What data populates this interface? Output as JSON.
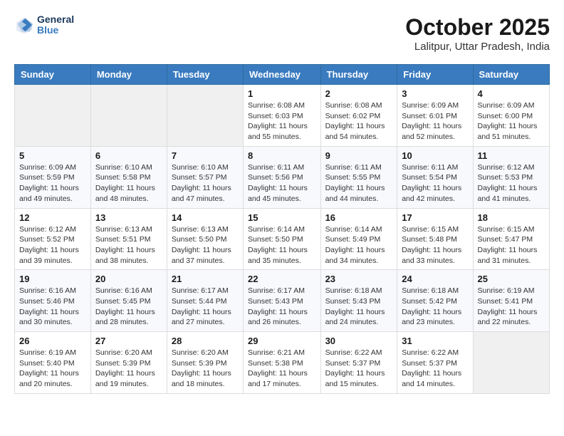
{
  "header": {
    "logo": {
      "general": "General",
      "blue": "Blue"
    },
    "title": "October 2025",
    "location": "Lalitpur, Uttar Pradesh, India"
  },
  "days_of_week": [
    "Sunday",
    "Monday",
    "Tuesday",
    "Wednesday",
    "Thursday",
    "Friday",
    "Saturday"
  ],
  "weeks": [
    [
      {
        "day": "",
        "info": ""
      },
      {
        "day": "",
        "info": ""
      },
      {
        "day": "",
        "info": ""
      },
      {
        "day": "1",
        "sunrise": "6:08 AM",
        "sunset": "6:03 PM",
        "daylight": "11 hours and 55 minutes."
      },
      {
        "day": "2",
        "sunrise": "6:08 AM",
        "sunset": "6:02 PM",
        "daylight": "11 hours and 54 minutes."
      },
      {
        "day": "3",
        "sunrise": "6:09 AM",
        "sunset": "6:01 PM",
        "daylight": "11 hours and 52 minutes."
      },
      {
        "day": "4",
        "sunrise": "6:09 AM",
        "sunset": "6:00 PM",
        "daylight": "11 hours and 51 minutes."
      }
    ],
    [
      {
        "day": "5",
        "sunrise": "6:09 AM",
        "sunset": "5:59 PM",
        "daylight": "11 hours and 49 minutes."
      },
      {
        "day": "6",
        "sunrise": "6:10 AM",
        "sunset": "5:58 PM",
        "daylight": "11 hours and 48 minutes."
      },
      {
        "day": "7",
        "sunrise": "6:10 AM",
        "sunset": "5:57 PM",
        "daylight": "11 hours and 47 minutes."
      },
      {
        "day": "8",
        "sunrise": "6:11 AM",
        "sunset": "5:56 PM",
        "daylight": "11 hours and 45 minutes."
      },
      {
        "day": "9",
        "sunrise": "6:11 AM",
        "sunset": "5:55 PM",
        "daylight": "11 hours and 44 minutes."
      },
      {
        "day": "10",
        "sunrise": "6:11 AM",
        "sunset": "5:54 PM",
        "daylight": "11 hours and 42 minutes."
      },
      {
        "day": "11",
        "sunrise": "6:12 AM",
        "sunset": "5:53 PM",
        "daylight": "11 hours and 41 minutes."
      }
    ],
    [
      {
        "day": "12",
        "sunrise": "6:12 AM",
        "sunset": "5:52 PM",
        "daylight": "11 hours and 39 minutes."
      },
      {
        "day": "13",
        "sunrise": "6:13 AM",
        "sunset": "5:51 PM",
        "daylight": "11 hours and 38 minutes."
      },
      {
        "day": "14",
        "sunrise": "6:13 AM",
        "sunset": "5:50 PM",
        "daylight": "11 hours and 37 minutes."
      },
      {
        "day": "15",
        "sunrise": "6:14 AM",
        "sunset": "5:50 PM",
        "daylight": "11 hours and 35 minutes."
      },
      {
        "day": "16",
        "sunrise": "6:14 AM",
        "sunset": "5:49 PM",
        "daylight": "11 hours and 34 minutes."
      },
      {
        "day": "17",
        "sunrise": "6:15 AM",
        "sunset": "5:48 PM",
        "daylight": "11 hours and 33 minutes."
      },
      {
        "day": "18",
        "sunrise": "6:15 AM",
        "sunset": "5:47 PM",
        "daylight": "11 hours and 31 minutes."
      }
    ],
    [
      {
        "day": "19",
        "sunrise": "6:16 AM",
        "sunset": "5:46 PM",
        "daylight": "11 hours and 30 minutes."
      },
      {
        "day": "20",
        "sunrise": "6:16 AM",
        "sunset": "5:45 PM",
        "daylight": "11 hours and 28 minutes."
      },
      {
        "day": "21",
        "sunrise": "6:17 AM",
        "sunset": "5:44 PM",
        "daylight": "11 hours and 27 minutes."
      },
      {
        "day": "22",
        "sunrise": "6:17 AM",
        "sunset": "5:43 PM",
        "daylight": "11 hours and 26 minutes."
      },
      {
        "day": "23",
        "sunrise": "6:18 AM",
        "sunset": "5:43 PM",
        "daylight": "11 hours and 24 minutes."
      },
      {
        "day": "24",
        "sunrise": "6:18 AM",
        "sunset": "5:42 PM",
        "daylight": "11 hours and 23 minutes."
      },
      {
        "day": "25",
        "sunrise": "6:19 AM",
        "sunset": "5:41 PM",
        "daylight": "11 hours and 22 minutes."
      }
    ],
    [
      {
        "day": "26",
        "sunrise": "6:19 AM",
        "sunset": "5:40 PM",
        "daylight": "11 hours and 20 minutes."
      },
      {
        "day": "27",
        "sunrise": "6:20 AM",
        "sunset": "5:39 PM",
        "daylight": "11 hours and 19 minutes."
      },
      {
        "day": "28",
        "sunrise": "6:20 AM",
        "sunset": "5:39 PM",
        "daylight": "11 hours and 18 minutes."
      },
      {
        "day": "29",
        "sunrise": "6:21 AM",
        "sunset": "5:38 PM",
        "daylight": "11 hours and 17 minutes."
      },
      {
        "day": "30",
        "sunrise": "6:22 AM",
        "sunset": "5:37 PM",
        "daylight": "11 hours and 15 minutes."
      },
      {
        "day": "31",
        "sunrise": "6:22 AM",
        "sunset": "5:37 PM",
        "daylight": "11 hours and 14 minutes."
      },
      {
        "day": "",
        "info": ""
      }
    ]
  ]
}
